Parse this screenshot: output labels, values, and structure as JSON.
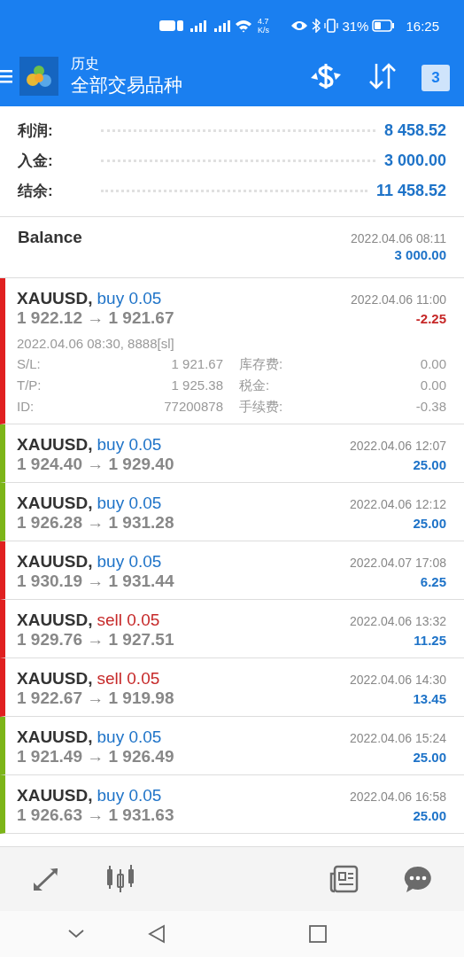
{
  "status_bar": {
    "speed": "4.7",
    "speed_unit": "K/s",
    "battery": "31%",
    "time": "16:25"
  },
  "header": {
    "title": "历史",
    "subtitle": "全部交易品种",
    "calendar_day": "3"
  },
  "summary": [
    {
      "label": "利润:",
      "value": "8 458.52"
    },
    {
      "label": "入金:",
      "value": "3 000.00"
    },
    {
      "label": "结余:",
      "value": "11 458.52"
    }
  ],
  "balance": {
    "label": "Balance",
    "time": "2022.04.06 08:11",
    "amount": "3 000.00"
  },
  "trades": [
    {
      "symbol": "XAUUSD,",
      "kind": "buy",
      "type": "buy 0.05",
      "prices": "1 922.12 → 1 921.67",
      "time": "2022.04.06 11:00",
      "profit": "-2.25",
      "color": "#e02020",
      "details": {
        "open": "2022.04.06 08:30, 8888[sl]",
        "fields": [
          {
            "label": "S/L:",
            "value": "1 921.67",
            "label2": "库存费:",
            "value2": "0.00"
          },
          {
            "label": "T/P:",
            "value": "1 925.38",
            "label2": "税金:",
            "value2": "0.00"
          },
          {
            "label": "ID:",
            "value": "77200878",
            "label2": "手续费:",
            "value2": "-0.38"
          }
        ]
      }
    },
    {
      "symbol": "XAUUSD,",
      "kind": "buy",
      "type": "buy 0.05",
      "prices": "1 924.40 → 1 929.40",
      "time": "2022.04.06 12:07",
      "profit": "25.00",
      "color": "#7cb518"
    },
    {
      "symbol": "XAUUSD,",
      "kind": "buy",
      "type": "buy 0.05",
      "prices": "1 926.28 → 1 931.28",
      "time": "2022.04.06 12:12",
      "profit": "25.00",
      "color": "#7cb518"
    },
    {
      "symbol": "XAUUSD,",
      "kind": "buy",
      "type": "buy 0.05",
      "prices": "1 930.19 → 1 931.44",
      "time": "2022.04.07 17:08",
      "profit": "6.25",
      "color": "#e02020"
    },
    {
      "symbol": "XAUUSD,",
      "kind": "sell",
      "type": "sell 0.05",
      "prices": "1 929.76 → 1 927.51",
      "time": "2022.04.06 13:32",
      "profit": "11.25",
      "color": "#e02020"
    },
    {
      "symbol": "XAUUSD,",
      "kind": "sell",
      "type": "sell 0.05",
      "prices": "1 922.67 → 1 919.98",
      "time": "2022.04.06 14:30",
      "profit": "13.45",
      "color": "#e02020"
    },
    {
      "symbol": "XAUUSD,",
      "kind": "buy",
      "type": "buy 0.05",
      "prices": "1 921.49 → 1 926.49",
      "time": "2022.04.06 15:24",
      "profit": "25.00",
      "color": "#7cb518"
    },
    {
      "symbol": "XAUUSD,",
      "kind": "buy",
      "type": "buy 0.05",
      "prices": "1 926.63 → 1 931.63",
      "time": "2022.04.06 16:58",
      "profit": "25.00",
      "color": "#7cb518"
    }
  ]
}
